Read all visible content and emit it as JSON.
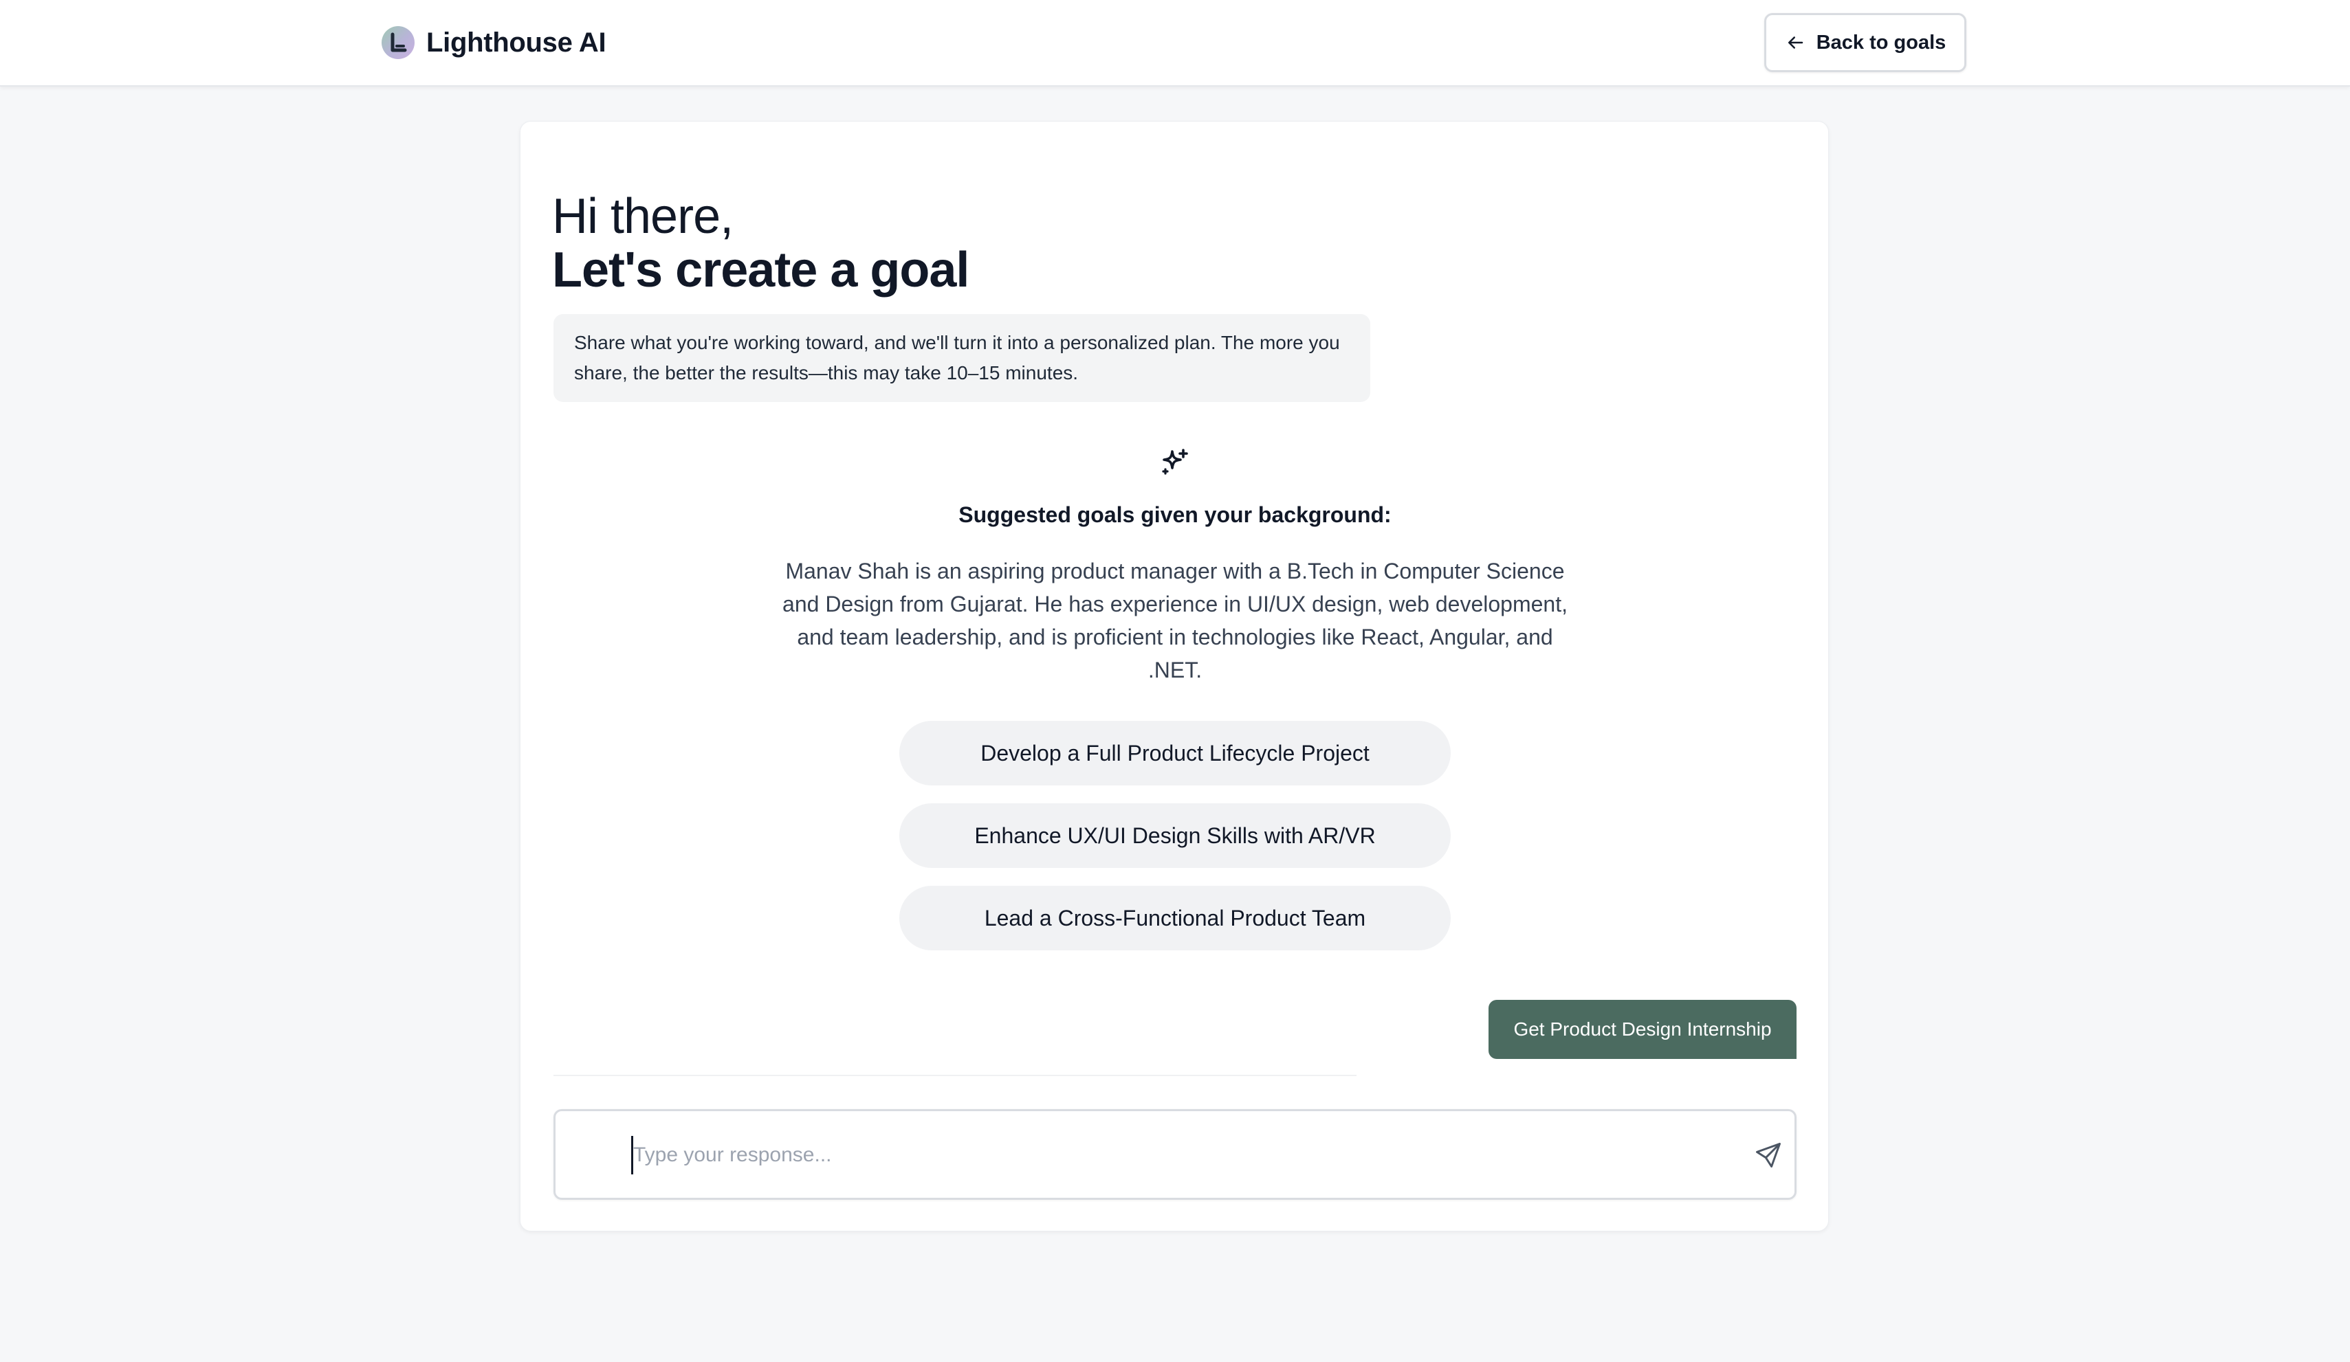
{
  "header": {
    "brand_name": "Lighthouse AI",
    "back_button_label": "Back to goals"
  },
  "intro": {
    "greeting": "Hi there,",
    "heading": "Let's create a goal",
    "description": "Share what you're working toward, and we'll turn it into a personalized plan. The more you share, the better the results—this may take 10–15 minutes."
  },
  "suggestions": {
    "title": "Suggested goals given your background:",
    "background_summary": "Manav Shah is an aspiring product manager with a B.Tech in Computer Science and Design from Gujarat. He has experience in UI/UX design, web development, and team leadership, and is proficient in technologies like React, Angular, and .NET.",
    "goals": [
      {
        "label": "Develop a Full Product Lifecycle Project"
      },
      {
        "label": "Enhance UX/UI Design Skills with AR/VR"
      },
      {
        "label": "Lead a Cross-Functional Product Team"
      }
    ]
  },
  "chat": {
    "user_message": "Get Product Design Internship"
  },
  "composer": {
    "placeholder": "Type your response...",
    "value": ""
  },
  "icons": {
    "logo": "lighthouse-logo",
    "back": "arrow-left-icon",
    "sparkle": "sparkles-icon",
    "send": "send-icon"
  },
  "colors": {
    "accent": "#4b6b60",
    "page_background": "#f6f7f9",
    "pill_background": "#f1f2f4"
  }
}
